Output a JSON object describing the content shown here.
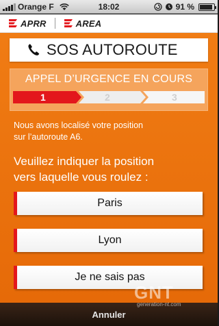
{
  "status_bar": {
    "carrier": "Orange F",
    "time": "18:02",
    "battery": "91 %",
    "battery_level": 0.91,
    "icons": [
      "signal-icon",
      "wifi-icon",
      "lock-icon",
      "alarm-icon",
      "battery-icon"
    ]
  },
  "brand": {
    "logo1": "APRR",
    "logo2": "AREA",
    "accent_color": "#e3171c"
  },
  "header": {
    "title": "SOS AUTOROUTE",
    "icon": "phone-icon"
  },
  "call": {
    "heading": "APPEL D’URGENCE EN COURS",
    "steps": [
      "1",
      "2",
      "3"
    ],
    "current_step": 1
  },
  "content": {
    "info_line1": "Nous avons localisé votre position",
    "info_line2": "sur l’autoroute A6.",
    "question_line1": "Veuillez indiquer la position",
    "question_line2": "vers laquelle vous roulez :"
  },
  "options": [
    {
      "label": "Paris"
    },
    {
      "label": "Lyon"
    },
    {
      "label": "Je ne sais pas"
    }
  ],
  "footer": {
    "cancel_label": "Annuler"
  },
  "watermark": {
    "logo": "GNT",
    "sub": "generation-nt.com"
  },
  "colors": {
    "primary_orange": "#ef7a12",
    "panel_orange": "#f5a45c",
    "step_active": "#e3171c",
    "footer": "#2a1a10"
  }
}
